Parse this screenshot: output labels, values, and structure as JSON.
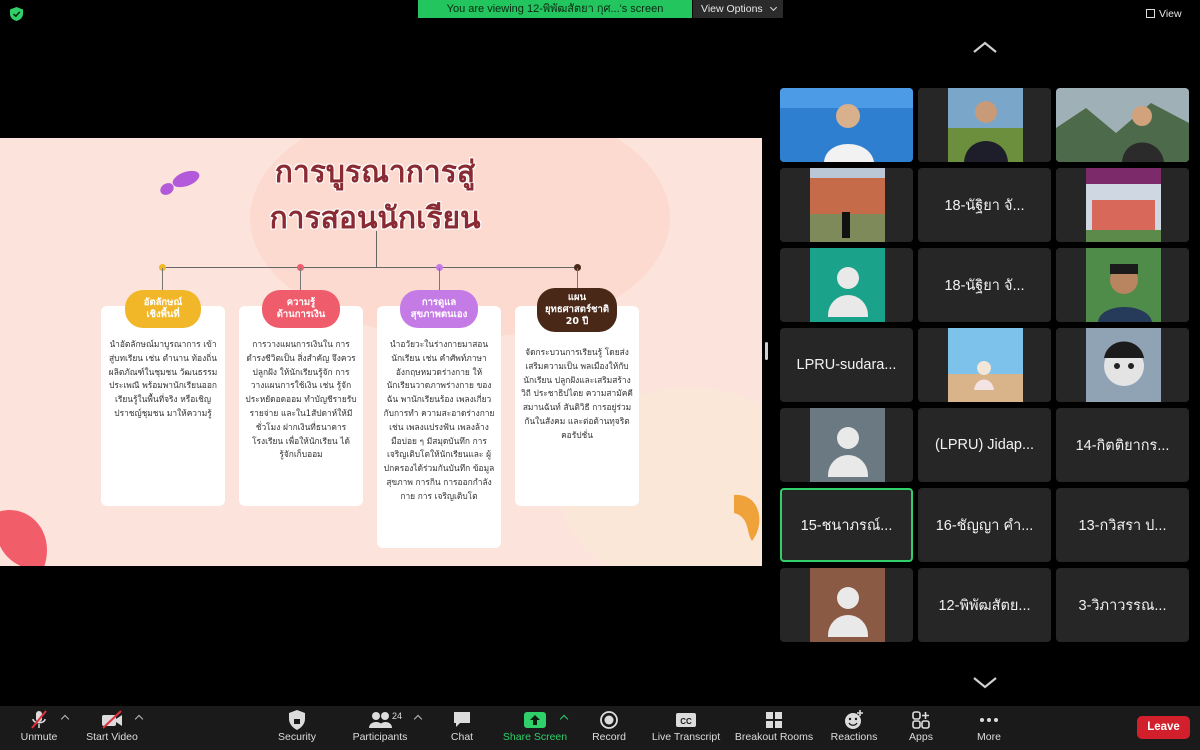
{
  "top_bar": {
    "banner_text": "You are viewing 12-พิพัฒสัตยา กุศ...'s screen",
    "view_options_label": "View Options",
    "view_label": "View"
  },
  "slide": {
    "title_line1": "การบูรณาการสู่",
    "title_line2": "การสอนนักเรียน",
    "cards": [
      {
        "heading_line1": "อัตลักษณ์",
        "heading_line2": "เชิงพื้นที่",
        "color": "#f2b728",
        "body": "นำอัตลักษณ์มาบูรณาการ เข้าสู่บทเรียน เช่น ตำนาน ท้องถิ่น ผลิตภัณฑ์ในชุมชน วัฒนธรรมประเพณี พร้อมพานักเรียนออกเรียนรู้ในพื้นที่จริง หรือเชิญปราชญ์ชุมชน มาให้ความรู้"
      },
      {
        "heading_line1": "ความรู้",
        "heading_line2": "ด้านการเงิน",
        "color": "#ef5d6c",
        "body": "การวางแผนการเงินใน การดำรงชีวิตเป็น สิ่งสำคัญ จึงควรปลูกฝัง ให้นักเรียนรู้จัก การวางแผนการใช้เงิน เช่น รู้จักประหยัดอดออม ทำบัญชีรายรับรายจ่าย และใน1สัปดาห์ให้มีชั่วโมง ฝากเงินที่ธนาคาร โรงเรียน เพื่อให้นักเรียน ได้รู้จักเก็บออม"
      },
      {
        "heading_line1": "การดูแล",
        "heading_line2": "สุขภาพตนเอง",
        "color": "#c57be6",
        "body": "นำอวัยวะในร่างกายมาสอน นักเรียน เช่น คำศัพท์ภาษา อังกฤษหมวดร่างกาย ให้นักเรียนวาดภาพร่างกาย ของฉัน พานักเรียนร้อง เพลงเกี่ยวกับการทำ ความสะอาดร่างกาย เช่น เพลงแปรงฟัน เพลงล้าง มือบ่อย ๆ มีสมุดบันทึก การ เจริญเติบโตให้นักเรียนและ ผู้ปกครองได้ร่วมกันบันทึก ข้อมูลสุขภาพ การกิน การออกกำลังกาย การ เจริญเติบโต"
      },
      {
        "heading_line1": "แผน",
        "heading_line2": "ยุทธศาสตร์ชาติ",
        "heading_line3": "20 ปี",
        "color": "#4a2818",
        "body": "จัดกระบวนการเรียนรู้ โดยส่งเสริมความเป็น พลเมืองให้กับนักเรียน ปลูกฝังและเสริมสร้างวิถี ประชาธิปไตย ความสามัคคี สมานฉันท์ สันติวิธี การอยู่ร่วมกันในสังคม และต่อต้านทุจริตคอรัปชั่น"
      }
    ]
  },
  "gallery": {
    "tiles": [
      {
        "type": "video",
        "scene": "man-blue-bg"
      },
      {
        "type": "video",
        "scene": "graduate"
      },
      {
        "type": "video",
        "scene": "woman-mountain"
      },
      {
        "type": "video",
        "scene": "building-person"
      },
      {
        "type": "name",
        "name": "18-นัฐิยา จั..."
      },
      {
        "type": "video",
        "scene": "school-poster"
      },
      {
        "type": "avatar",
        "bg": "#1aa38a"
      },
      {
        "type": "name",
        "name": "18-นัฐิยา จั..."
      },
      {
        "type": "video",
        "scene": "man-selfie"
      },
      {
        "type": "name",
        "name": "LPRU-sudara..."
      },
      {
        "type": "video",
        "scene": "sky-woman"
      },
      {
        "type": "video",
        "scene": "cartoon-face"
      },
      {
        "type": "avatar",
        "bg": "#6b7a82"
      },
      {
        "type": "name",
        "name": "(LPRU) Jidap..."
      },
      {
        "type": "name",
        "name": "14-กิตติยากร..."
      },
      {
        "type": "name",
        "name": "15-ชนาภรณ์...",
        "active": true
      },
      {
        "type": "name",
        "name": "16-ชัญญา คำ..."
      },
      {
        "type": "name",
        "name": "13-กวิสรา ป..."
      },
      {
        "type": "avatar",
        "bg": "#8b5a44"
      },
      {
        "type": "name",
        "name": "12-พิพัฒสัตย..."
      },
      {
        "type": "name",
        "name": "3-วิภาวรรณ..."
      }
    ]
  },
  "toolbar": {
    "unmute": "Unmute",
    "start_video": "Start Video",
    "security": "Security",
    "participants": "Participants",
    "participants_count": "24",
    "chat": "Chat",
    "share_screen": "Share Screen",
    "record": "Record",
    "live_transcript": "Live Transcript",
    "breakout_rooms": "Breakout Rooms",
    "reactions": "Reactions",
    "apps": "Apps",
    "more": "More",
    "leave": "Leave",
    "accent_green": "#2fd06a",
    "leave_red": "#d11f2b"
  }
}
